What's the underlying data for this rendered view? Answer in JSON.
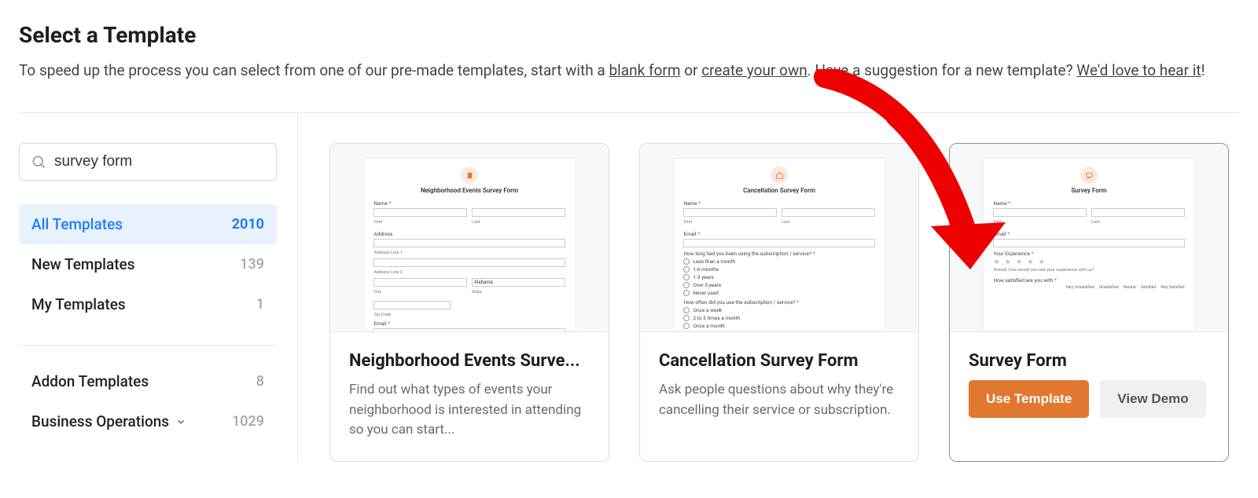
{
  "header": {
    "title": "Select a Template",
    "intro_prefix": "To speed up the process you can select from one of our pre-made templates, start with a ",
    "link_blank": "blank form",
    "intro_mid": " or ",
    "link_create": "create your own",
    "intro_suffix1": ". Have a suggestion for a new template? ",
    "link_suggest": "We'd love to hear it",
    "intro_suffix2": "!"
  },
  "search": {
    "value": "survey form"
  },
  "sidebar": {
    "categories": [
      {
        "label": "All Templates",
        "count": "2010",
        "active": true
      },
      {
        "label": "New Templates",
        "count": "139",
        "active": false
      },
      {
        "label": "My Templates",
        "count": "1",
        "active": false
      }
    ],
    "extra": [
      {
        "label": "Addon Templates",
        "count": "8",
        "chevron": false
      },
      {
        "label": "Business Operations",
        "count": "1029",
        "chevron": true
      }
    ]
  },
  "templates": [
    {
      "title": "Neighborhood Events Surve...",
      "desc": "Find out what types of events your neighborhood is interested in attending so you can start...",
      "preview_title": "Neighborhood Events Survey Form",
      "hovered": false
    },
    {
      "title": "Cancellation Survey Form",
      "desc": "Ask people questions about why they're cancelling their service or subscription.",
      "preview_title": "Cancellation Survey Form",
      "hovered": false
    },
    {
      "title": "Survey Form",
      "desc": "",
      "preview_title": "Survey Form",
      "hovered": true
    }
  ],
  "buttons": {
    "use": "Use Template",
    "demo": "View Demo"
  },
  "preview": {
    "name_label": "Name",
    "first_sub": "First",
    "last_sub": "Last",
    "address_label": "Address",
    "addr1_sub": "Address Line 1",
    "addr2_sub": "Address Line 2",
    "city_sub": "City",
    "state_sub": "State",
    "state_val": "Alabama",
    "zip_sub": "Zip Code",
    "email_label": "Email",
    "how_long": "How long had you been using the subscription / service?",
    "opts_long": [
      "Less than a month",
      "1-6 months",
      "1-3 years",
      "Over 3 years",
      "Never used"
    ],
    "how_often": "How often did you use the subscription / service?",
    "opts_often": [
      "Once a week",
      "2 to 3 times a month",
      "Once a month"
    ],
    "experience_label": "Your Experience",
    "overall": "Overall, how would you rate your experience with us?",
    "satisfied_label": "How satisfied are you with",
    "scale": [
      "Very Unsatisfied",
      "Unsatisfied",
      "Neutral",
      "Satisfied",
      "Very Satisfied"
    ]
  }
}
